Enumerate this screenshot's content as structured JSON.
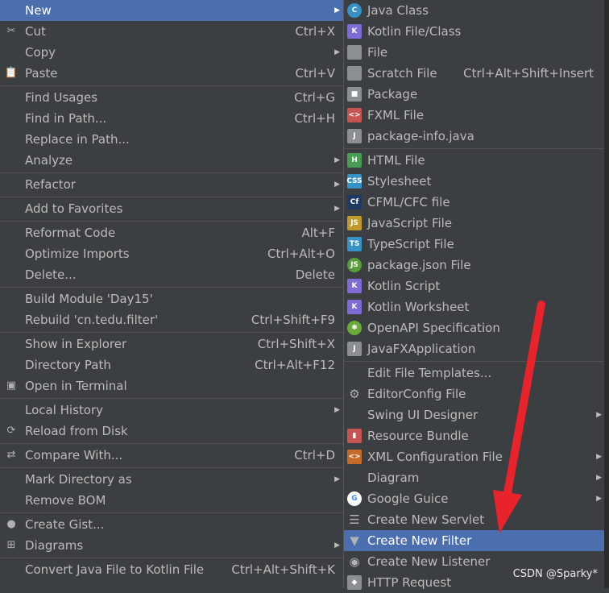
{
  "left_menu": {
    "items": [
      {
        "label": "New",
        "shortcut": "",
        "submenu": true,
        "selected": true,
        "icon": ""
      },
      {
        "label": "Cut",
        "shortcut": "Ctrl+X",
        "icon": "scissors-icon",
        "glyph": "✂"
      },
      {
        "label": "Copy",
        "shortcut": "",
        "submenu": true,
        "icon": ""
      },
      {
        "label": "Paste",
        "shortcut": "Ctrl+V",
        "icon": "clipboard-icon",
        "glyph": "📋"
      },
      {
        "label": "Find Usages",
        "shortcut": "Ctrl+G",
        "sep_before": true
      },
      {
        "label": "Find in Path...",
        "shortcut": "Ctrl+H"
      },
      {
        "label": "Replace in Path...",
        "shortcut": ""
      },
      {
        "label": "Analyze",
        "shortcut": "",
        "submenu": true
      },
      {
        "label": "Refactor",
        "shortcut": "",
        "submenu": true,
        "sep_before": true
      },
      {
        "label": "Add to Favorites",
        "shortcut": "",
        "submenu": true,
        "sep_before": true
      },
      {
        "label": "Reformat Code",
        "shortcut": "Alt+F",
        "sep_before": true
      },
      {
        "label": "Optimize Imports",
        "shortcut": "Ctrl+Alt+O"
      },
      {
        "label": "Delete...",
        "shortcut": "Delete"
      },
      {
        "label": "Build Module 'Day15'",
        "shortcut": "",
        "sep_before": true
      },
      {
        "label": "Rebuild 'cn.tedu.filter'",
        "shortcut": "Ctrl+Shift+F9"
      },
      {
        "label": "Show in Explorer",
        "shortcut": "Ctrl+Shift+X",
        "sep_before": true
      },
      {
        "label": "Directory Path",
        "shortcut": "Ctrl+Alt+F12"
      },
      {
        "label": "Open in Terminal",
        "shortcut": "",
        "icon": "terminal-icon",
        "glyph": "▣"
      },
      {
        "label": "Local History",
        "shortcut": "",
        "submenu": true,
        "sep_before": true
      },
      {
        "label": "Reload from Disk",
        "shortcut": "",
        "icon": "reload-icon",
        "glyph": "⟳"
      },
      {
        "label": "Compare With...",
        "shortcut": "Ctrl+D",
        "icon": "compare-icon",
        "glyph": "⇄",
        "sep_before": true
      },
      {
        "label": "Mark Directory as",
        "shortcut": "",
        "submenu": true,
        "sep_before": true
      },
      {
        "label": "Remove BOM",
        "shortcut": ""
      },
      {
        "label": "Create Gist...",
        "shortcut": "",
        "icon": "github-icon",
        "glyph": "●",
        "sep_before": true
      },
      {
        "label": "Diagrams",
        "shortcut": "",
        "submenu": true,
        "icon": "diagram-icon",
        "glyph": "⊞"
      },
      {
        "label": "Convert Java File to Kotlin File",
        "shortcut": "Ctrl+Alt+Shift+K",
        "sep_before": true
      }
    ]
  },
  "right_menu": {
    "items": [
      {
        "label": "Java Class",
        "shortcut": "",
        "icon": "java-class-icon",
        "glyph": "C",
        "color": "#3592c4",
        "circle": true
      },
      {
        "label": "Kotlin File/Class",
        "shortcut": "",
        "icon": "kotlin-icon",
        "glyph": "K",
        "color": "#7f6bd6"
      },
      {
        "label": "File",
        "shortcut": "",
        "icon": "file-icon",
        "glyph": "",
        "color": "#8c8f92"
      },
      {
        "label": "Scratch File",
        "shortcut": "Ctrl+Alt+Shift+Insert",
        "icon": "scratch-file-icon",
        "glyph": "",
        "color": "#8c8f92"
      },
      {
        "label": "Package",
        "shortcut": "",
        "icon": "package-icon",
        "glyph": "■",
        "color": "#8c8f92"
      },
      {
        "label": "FXML File",
        "shortcut": "",
        "icon": "fxml-icon",
        "glyph": "<>",
        "color": "#c75450"
      },
      {
        "label": "package-info.java",
        "shortcut": "",
        "icon": "package-info-icon",
        "glyph": "J",
        "color": "#8c8f92"
      },
      {
        "label": "HTML File",
        "shortcut": "",
        "icon": "html-icon",
        "glyph": "H",
        "color": "#499c54",
        "sep_before": true
      },
      {
        "label": "Stylesheet",
        "shortcut": "",
        "icon": "css-icon",
        "glyph": "CSS",
        "color": "#3592c4"
      },
      {
        "label": "CFML/CFC file",
        "shortcut": "",
        "icon": "cfml-icon",
        "glyph": "Cf",
        "color": "#1d3a64"
      },
      {
        "label": "JavaScript File",
        "shortcut": "",
        "icon": "javascript-icon",
        "glyph": "JS",
        "color": "#c09a2b"
      },
      {
        "label": "TypeScript File",
        "shortcut": "",
        "icon": "typescript-icon",
        "glyph": "TS",
        "color": "#3592c4"
      },
      {
        "label": "package.json File",
        "shortcut": "",
        "icon": "nodejs-icon",
        "glyph": "JS",
        "color": "#5a9e3a",
        "circle": true
      },
      {
        "label": "Kotlin Script",
        "shortcut": "",
        "icon": "kotlin-script-icon",
        "glyph": "K",
        "color": "#7f6bd6"
      },
      {
        "label": "Kotlin Worksheet",
        "shortcut": "",
        "icon": "kotlin-worksheet-icon",
        "glyph": "K",
        "color": "#7f6bd6"
      },
      {
        "label": "OpenAPI Specification",
        "shortcut": "",
        "icon": "openapi-icon",
        "glyph": "✱",
        "color": "#6aab3a",
        "circle": true
      },
      {
        "label": "JavaFXApplication",
        "shortcut": "",
        "icon": "javafx-icon",
        "glyph": "J",
        "color": "#8c8f92"
      },
      {
        "label": "Edit File Templates...",
        "shortcut": "",
        "sep_before": true
      },
      {
        "label": "EditorConfig File",
        "shortcut": "",
        "icon": "gear-icon",
        "glyph": "⚙",
        "color": "transparent"
      },
      {
        "label": "Swing UI Designer",
        "shortcut": "",
        "submenu": true
      },
      {
        "label": "Resource Bundle",
        "shortcut": "",
        "icon": "resource-bundle-icon",
        "glyph": "▮",
        "color": "#c75450"
      },
      {
        "label": "XML Configuration File",
        "shortcut": "",
        "submenu": true,
        "icon": "xml-icon",
        "glyph": "<>",
        "color": "#c76b29"
      },
      {
        "label": "Diagram",
        "shortcut": "",
        "submenu": true
      },
      {
        "label": "Google Guice",
        "shortcut": "",
        "submenu": true,
        "icon": "google-icon",
        "glyph": "G",
        "color": "#ffffff",
        "circle": true
      },
      {
        "label": "Create New Servlet",
        "shortcut": "",
        "icon": "servlet-icon",
        "glyph": "☰",
        "color": "transparent"
      },
      {
        "label": "Create New Filter",
        "shortcut": "",
        "icon": "filter-icon",
        "glyph": "▼",
        "color": "transparent",
        "selected": true
      },
      {
        "label": "Create New Listener",
        "shortcut": "",
        "icon": "listener-icon",
        "glyph": "◉",
        "color": "transparent"
      },
      {
        "label": "HTTP Request",
        "shortcut": "",
        "icon": "http-icon",
        "glyph": "◆",
        "color": "#8c8f92"
      }
    ]
  },
  "watermark": "CSDN @Sparky*",
  "annotation_color": "#e8232b"
}
